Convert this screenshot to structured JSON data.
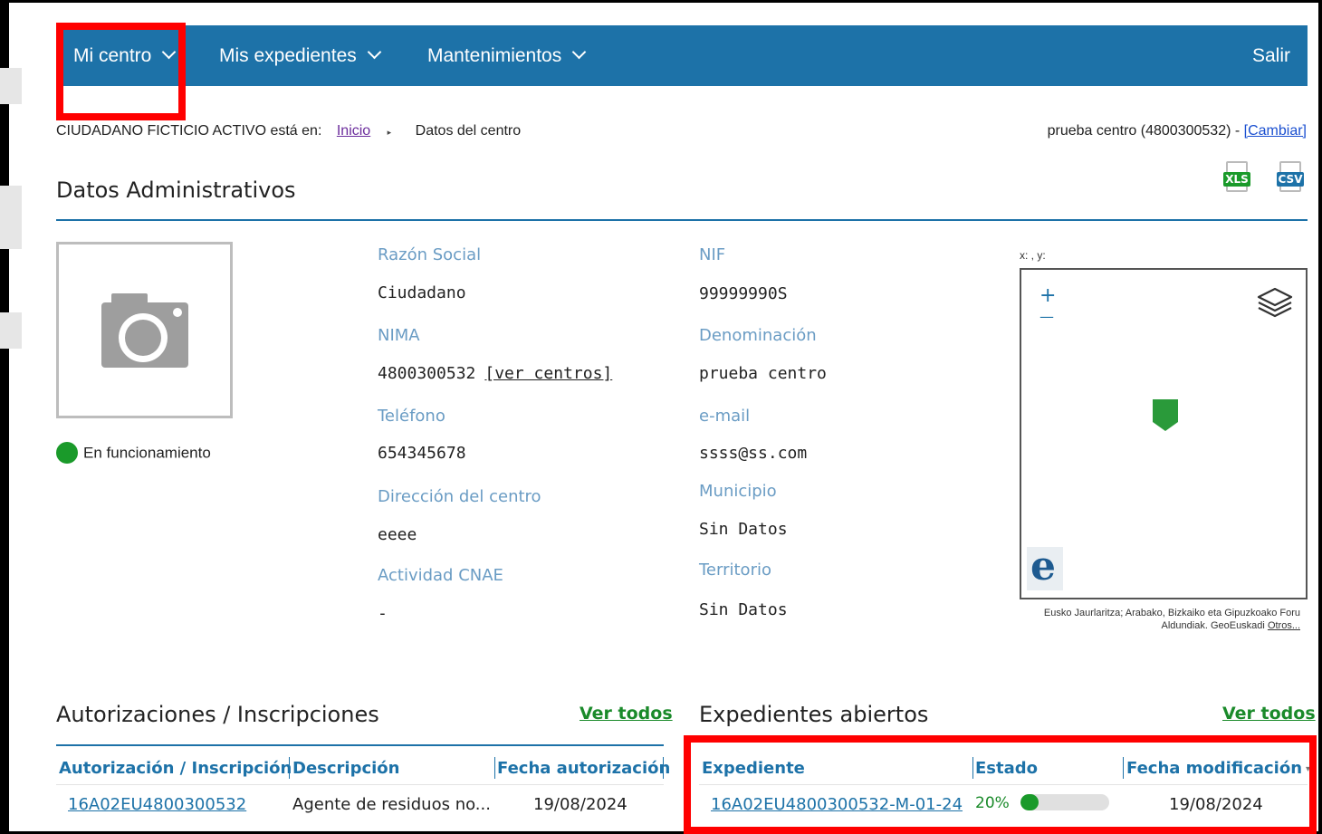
{
  "nav": {
    "items": [
      {
        "label": "Mi centro"
      },
      {
        "label": "Mis expedientes"
      },
      {
        "label": "Mantenimientos"
      }
    ],
    "logout": "Salir",
    "bg_color": "#1d72a8"
  },
  "breadcrumb": {
    "user_prefix": "CIUDADANO FICTICIO ACTIVO está en:",
    "home": "Inicio",
    "current": "Datos del centro"
  },
  "center_selector": {
    "text": "prueba centro (4800300532) - ",
    "change_link": "[Cambiar]"
  },
  "export": {
    "xls": {
      "label": "XLS",
      "icon": "xls-file-icon",
      "color": "#1a9a2a"
    },
    "csv": {
      "label": "CSV",
      "icon": "csv-file-icon",
      "color": "#1d72a8"
    }
  },
  "datos_administrativos": {
    "title": "Datos Administrativos",
    "status": {
      "label": "En funcionamiento",
      "color": "#1a9a2a"
    },
    "fields": {
      "razon_social": {
        "label": "Razón Social",
        "value": "Ciudadano"
      },
      "nif": {
        "label": "NIF",
        "value": "99999990S"
      },
      "nima": {
        "label": "NIMA",
        "value": "4800300532",
        "link": "[ver centros]"
      },
      "denominacion": {
        "label": "Denominación",
        "value": "prueba centro"
      },
      "telefono": {
        "label": "Teléfono",
        "value": "654345678"
      },
      "email": {
        "label": "e-mail",
        "value": "ssss@ss.com"
      },
      "direccion": {
        "label": "Dirección del centro",
        "value": "eeee"
      },
      "municipio": {
        "label": "Municipio",
        "value": "Sin Datos"
      },
      "actividad_cnae": {
        "label": "Actividad CNAE",
        "value": "-"
      },
      "territorio": {
        "label": "Territorio",
        "value": "Sin Datos"
      }
    }
  },
  "map": {
    "coords": "x: , y:",
    "zoom_in": "+",
    "zoom_out": "—",
    "logo": "e",
    "attribution": "Eusko Jaurlaritza; Arabako, Bizkaiko eta Gipuzkoako Foru Aldundiak. GeoEuskadi",
    "attribution_more": "Otros..."
  },
  "autorizaciones": {
    "title": "Autorizaciones / Inscripciones",
    "view_all": "Ver todos",
    "columns": [
      "Autorización / Inscripción",
      "Descripción",
      "Fecha autorización"
    ],
    "rows": [
      {
        "code": "16A02EU4800300532",
        "description": "Agente de residuos no...",
        "date": "19/08/2024"
      }
    ]
  },
  "expedientes": {
    "title": "Expedientes abiertos",
    "view_all": "Ver todos",
    "columns": [
      "Expediente",
      "Estado",
      "Fecha modificación"
    ],
    "sort_icon": "sort-icon",
    "rows": [
      {
        "code": "16A02EU4800300532-M-01-24",
        "progress_label": "20%",
        "progress": 0.2,
        "date": "19/08/2024"
      }
    ]
  }
}
